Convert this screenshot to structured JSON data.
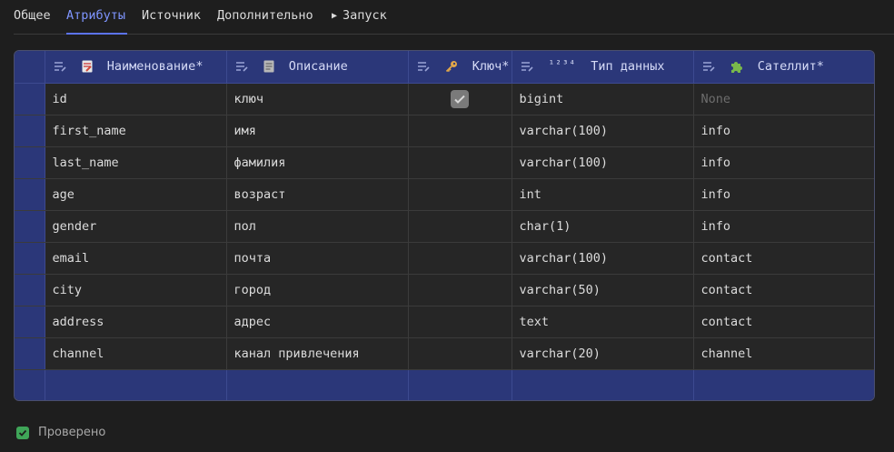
{
  "tabs": [
    {
      "label": "Общее"
    },
    {
      "label": "Атрибуты"
    },
    {
      "label": "Источник"
    },
    {
      "label": "Дополнительно"
    },
    {
      "label": "Запуск"
    }
  ],
  "active_tab_index": 1,
  "table": {
    "columns": [
      {
        "label": "Наименование*",
        "icon": "document-icon"
      },
      {
        "label": "Описание",
        "icon": "note-icon"
      },
      {
        "label": "Ключ*",
        "icon": "key-icon"
      },
      {
        "label": "Тип данных",
        "icon": "numeric-type-icon",
        "icon_text": "¹²³⁴"
      },
      {
        "label": "Сателлит*",
        "icon": "puzzle-icon"
      }
    ],
    "rows": [
      {
        "name": "id",
        "description": "ключ",
        "key": true,
        "type": "bigint",
        "satellite": "None"
      },
      {
        "name": "first_name",
        "description": "имя",
        "key": false,
        "type": "varchar(100)",
        "satellite": "info"
      },
      {
        "name": "last_name",
        "description": "фамилия",
        "key": false,
        "type": "varchar(100)",
        "satellite": "info"
      },
      {
        "name": "age",
        "description": "возраст",
        "key": false,
        "type": "int",
        "satellite": "info"
      },
      {
        "name": "gender",
        "description": "пол",
        "key": false,
        "type": "char(1)",
        "satellite": "info"
      },
      {
        "name": "email",
        "description": "почта",
        "key": false,
        "type": "varchar(100)",
        "satellite": "contact"
      },
      {
        "name": "city",
        "description": "город",
        "key": false,
        "type": "varchar(50)",
        "satellite": "contact"
      },
      {
        "name": "address",
        "description": "адрес",
        "key": false,
        "type": "text",
        "satellite": "contact"
      },
      {
        "name": "channel",
        "description": "канал привлечения",
        "key": false,
        "type": "varchar(20)",
        "satellite": "channel"
      }
    ]
  },
  "footer": {
    "verified_label": "Проверено",
    "verified": true
  },
  "colors": {
    "accent": "#5c73f2",
    "header_bg": "#2b3779",
    "background": "#1e1e1e",
    "check_green": "#3fa558"
  }
}
